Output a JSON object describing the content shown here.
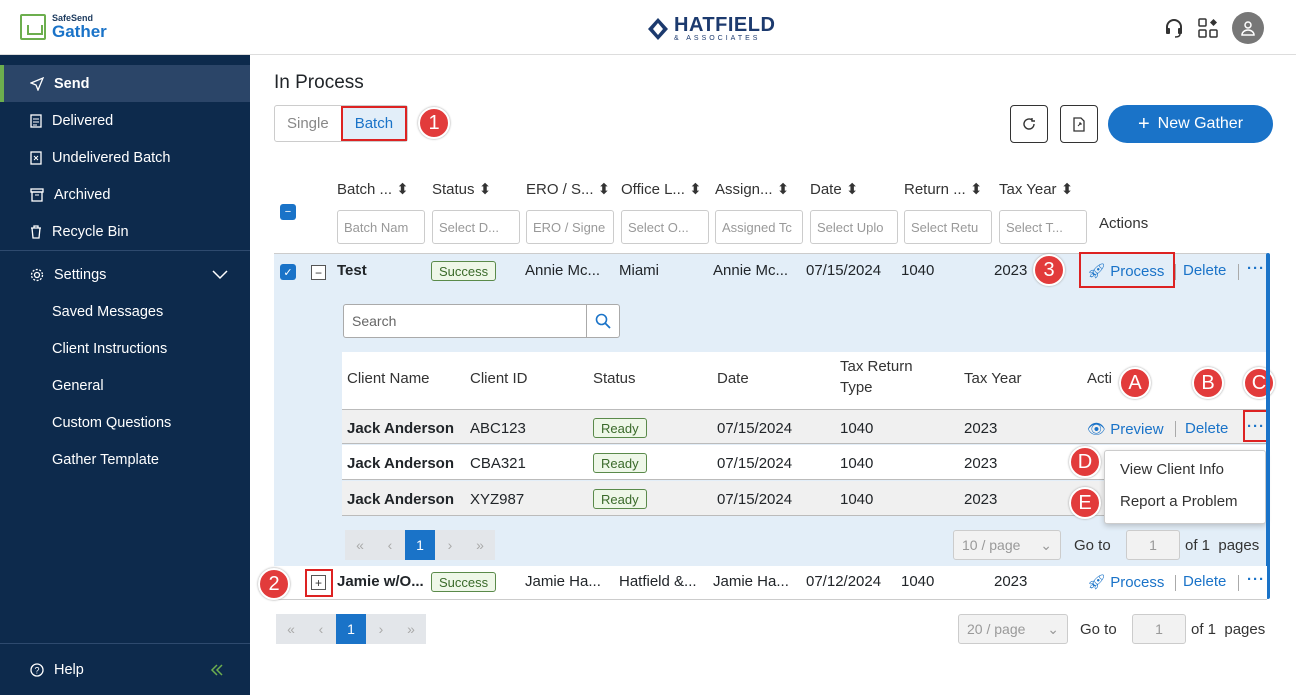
{
  "header": {
    "logo_small": "SafeSend",
    "logo_big": "Gather",
    "brand_name": "HATFIELD",
    "brand_sub": "& ASSOCIATES"
  },
  "sidebar": {
    "items": [
      {
        "label": "Send"
      },
      {
        "label": "Delivered"
      },
      {
        "label": "Undelivered Batch"
      },
      {
        "label": "Archived"
      },
      {
        "label": "Recycle Bin"
      }
    ],
    "settings": "Settings",
    "sub": [
      {
        "label": "Saved Messages"
      },
      {
        "label": "Client Instructions"
      },
      {
        "label": "General"
      },
      {
        "label": "Custom Questions"
      },
      {
        "label": "Gather Template"
      }
    ],
    "help": "Help"
  },
  "page": {
    "title": "In Process",
    "seg_single": "Single",
    "seg_batch": "Batch",
    "new_button": "New Gather"
  },
  "table": {
    "headers": [
      "Batch ...",
      "Status",
      "ERO / S...",
      "Office L...",
      "Assign...",
      "Date",
      "Return ...",
      "Tax Year",
      "Actions"
    ],
    "filters": [
      "Batch Nam",
      "Select D...",
      "ERO / Signe",
      "Select O...",
      "Assigned Tc",
      "Select Uplo",
      "Select Retu",
      "Select T..."
    ],
    "rows": [
      {
        "name": "Test",
        "status": "Success",
        "ero": "Annie Mc...",
        "office": "Miami",
        "assigned": "Annie Mc...",
        "date": "07/15/2024",
        "ret": "1040",
        "year": "2023",
        "process": "Process",
        "delete": "Delete"
      },
      {
        "name": "Jamie w/O...",
        "status": "Success",
        "ero": "Jamie Ha...",
        "office": "Hatfield &...",
        "assigned": "Jamie Ha...",
        "date": "07/12/2024",
        "ret": "1040",
        "year": "2023",
        "process": "Process",
        "delete": "Delete"
      }
    ]
  },
  "nested": {
    "search_placeholder": "Search",
    "headers": {
      "client_name": "Client Name",
      "client_id": "Client ID",
      "status": "Status",
      "date": "Date",
      "type_1": "Tax Return",
      "type_2": "Type",
      "year": "Tax Year",
      "actions": "Acti"
    },
    "rows": [
      {
        "name": "Jack Anderson",
        "id": "ABC123",
        "status": "Ready",
        "date": "07/15/2024",
        "type": "1040",
        "year": "2023"
      },
      {
        "name": "Jack Anderson",
        "id": "CBA321",
        "status": "Ready",
        "date": "07/15/2024",
        "type": "1040",
        "year": "2023"
      },
      {
        "name": "Jack Anderson",
        "id": "XYZ987",
        "status": "Ready",
        "date": "07/15/2024",
        "type": "1040",
        "year": "2023"
      }
    ],
    "preview": "Preview",
    "delete": "Delete",
    "menu": [
      "View Client Info",
      "Report a Problem"
    ],
    "page": "1",
    "per_page": "10 / page",
    "goto": "Go to",
    "goto_val": "1",
    "of": "of 1",
    "pages": "pages"
  },
  "pagination": {
    "page": "1",
    "per_page": "20 / page",
    "goto": "Go to",
    "goto_val": "1",
    "of": "of 1",
    "pages": "pages"
  },
  "badges": [
    "1",
    "2",
    "3",
    "A",
    "B",
    "C",
    "D",
    "E"
  ]
}
